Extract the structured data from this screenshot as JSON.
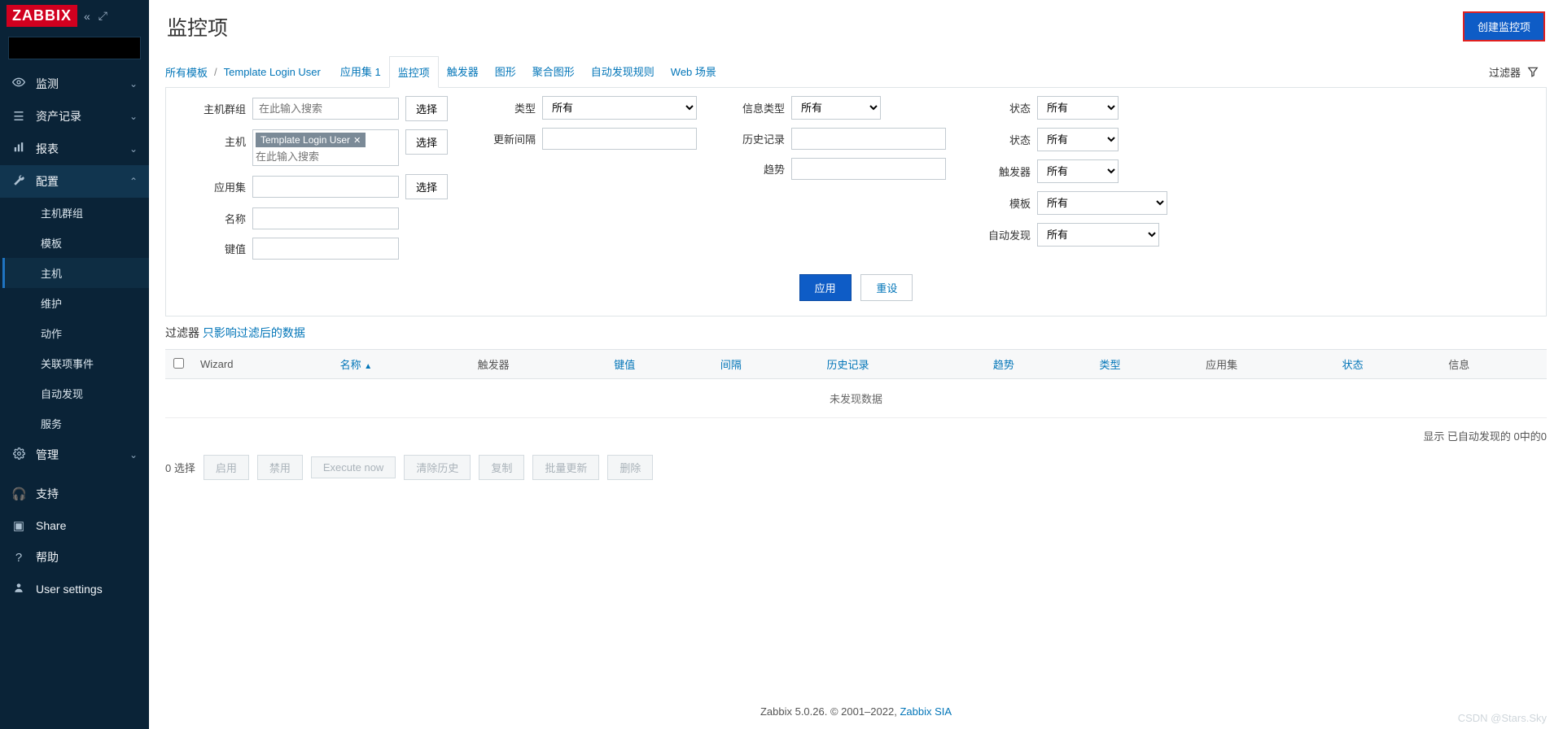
{
  "logo": "ZABBIX",
  "sidebar": {
    "search_placeholder": "",
    "nav": [
      {
        "icon": "eye",
        "label": "监测",
        "expand": true
      },
      {
        "icon": "list",
        "label": "资产记录",
        "expand": true
      },
      {
        "icon": "bar",
        "label": "报表",
        "expand": true
      },
      {
        "icon": "wrench",
        "label": "配置",
        "expand": true,
        "active": true,
        "children": [
          {
            "label": "主机群组"
          },
          {
            "label": "模板"
          },
          {
            "label": "主机",
            "active": true
          },
          {
            "label": "维护"
          },
          {
            "label": "动作"
          },
          {
            "label": "关联项事件"
          },
          {
            "label": "自动发现"
          },
          {
            "label": "服务"
          }
        ]
      },
      {
        "icon": "gear",
        "label": "管理",
        "expand": true
      }
    ],
    "bottom": [
      {
        "icon": "headset",
        "label": "支持"
      },
      {
        "icon": "z",
        "label": "Share"
      },
      {
        "icon": "q",
        "label": "帮助"
      },
      {
        "icon": "user",
        "label": "User settings"
      }
    ]
  },
  "header": {
    "title": "监控项",
    "create_btn": "创建监控项"
  },
  "breadcrumb": [
    {
      "text": "所有模板",
      "link": true
    },
    {
      "text": "Template Login User",
      "link": true
    }
  ],
  "tabs": [
    {
      "label": "应用集 1"
    },
    {
      "label": "监控项",
      "active": true,
      "highlight": true
    },
    {
      "label": "触发器"
    },
    {
      "label": "图形"
    },
    {
      "label": "聚合图形"
    },
    {
      "label": "自动发现规则"
    },
    {
      "label": "Web 场景"
    }
  ],
  "filter_toggle": "过滤器",
  "filter": {
    "col1": {
      "hostgroup": {
        "label": "主机群组",
        "ph": "在此输入搜索",
        "btn": "选择"
      },
      "host": {
        "label": "主机",
        "tag": "Template Login User",
        "ph": "在此输入搜索",
        "btn": "选择"
      },
      "appset": {
        "label": "应用集",
        "btn": "选择"
      },
      "name": {
        "label": "名称"
      },
      "key": {
        "label": "键值"
      }
    },
    "col2": {
      "type": {
        "label": "类型",
        "val": "所有"
      },
      "update_int": {
        "label": "更新间隔"
      }
    },
    "col3": {
      "info_type": {
        "label": "信息类型",
        "val": "所有"
      },
      "history": {
        "label": "历史记录"
      },
      "trend": {
        "label": "趋势"
      }
    },
    "col4": {
      "state": {
        "label": "状态",
        "val": "所有"
      },
      "status": {
        "label": "状态",
        "val": "所有"
      },
      "trigger": {
        "label": "触发器",
        "val": "所有"
      },
      "template": {
        "label": "模板",
        "val": "所有"
      },
      "autodisc": {
        "label": "自动发现",
        "val": "所有"
      }
    },
    "apply": "应用",
    "reset": "重设"
  },
  "msg": {
    "head": "过滤器 ",
    "link": "只影响过滤后的数据"
  },
  "table": {
    "headers": [
      "",
      "Wizard",
      "名称",
      "触发器",
      "键值",
      "间隔",
      "历史记录",
      "趋势",
      "类型",
      "应用集",
      "状态",
      "信息"
    ],
    "sort_col": "名称",
    "nodata": "未发现数据"
  },
  "table_foot": "显示 已自动发现的 0中的0",
  "bottom": {
    "selected": "0 选择",
    "btns": [
      "启用",
      "禁用",
      "Execute now",
      "清除历史",
      "复制",
      "批量更新",
      "删除"
    ]
  },
  "footer": {
    "text1": "Zabbix 5.0.26. © 2001–2022, ",
    "link": "Zabbix SIA"
  },
  "watermark": "CSDN @Stars.Sky"
}
